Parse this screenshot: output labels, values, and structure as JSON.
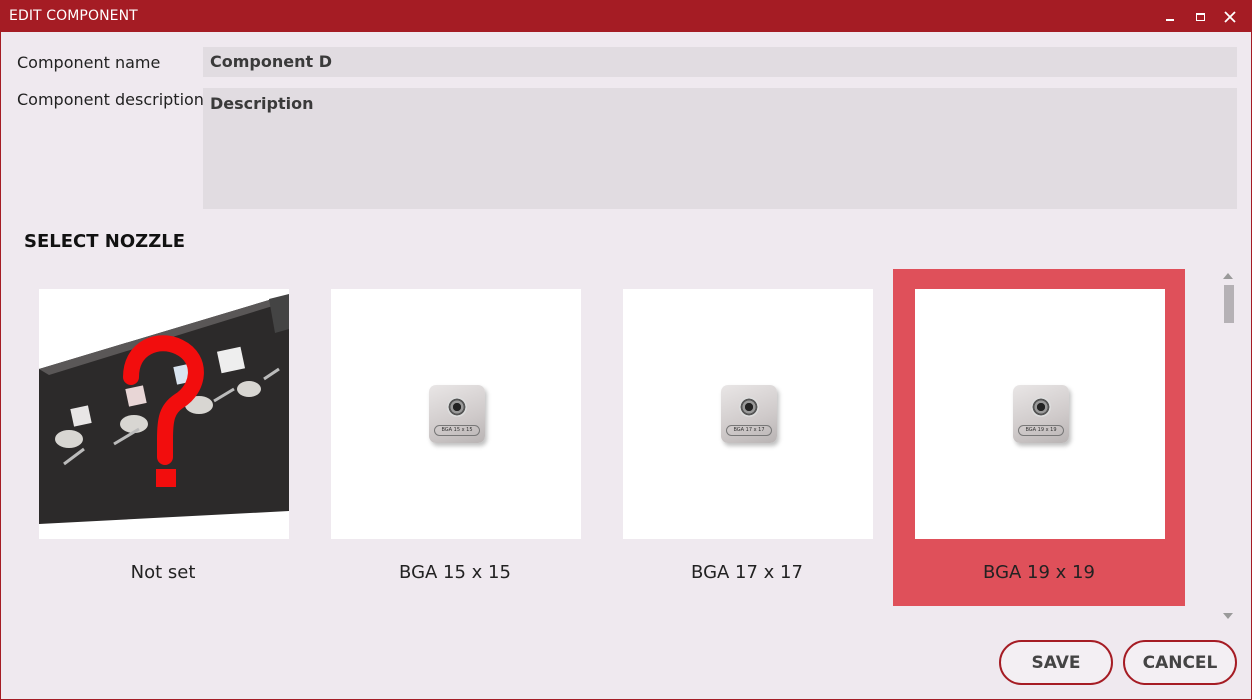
{
  "window": {
    "title": "EDIT COMPONENT",
    "accent_color": "#a51c24",
    "controls": [
      "minimize-icon",
      "maximize-icon",
      "close-icon"
    ]
  },
  "form": {
    "name_label": "Component name",
    "name_value": "Component D",
    "description_label": "Component description",
    "description_value": "Description"
  },
  "nozzle_section": {
    "title": "SELECT NOZZLE",
    "selected_index": 3,
    "selected_color": "#df505a",
    "options": [
      {
        "label": "Not set",
        "image": "question-mark-tray-image"
      },
      {
        "label": "BGA 15 x 15",
        "image_text": "BGA 15 x 15"
      },
      {
        "label": "BGA 17 x 17",
        "image_text": "BGA 17 x 17"
      },
      {
        "label": "BGA 19 x 19",
        "image_text": "BGA 19 x 19"
      }
    ]
  },
  "actions": {
    "save_label": "SAVE",
    "cancel_label": "CANCEL"
  }
}
